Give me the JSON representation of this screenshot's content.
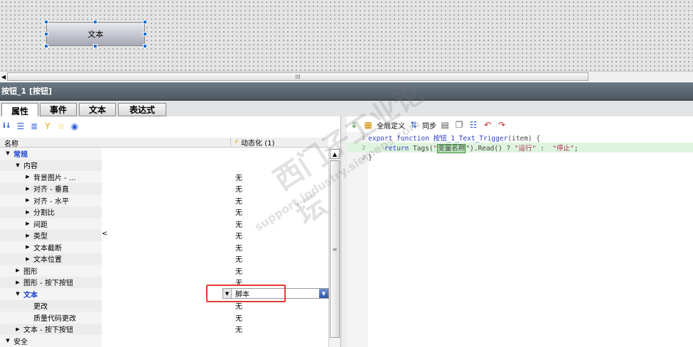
{
  "canvas": {
    "widget_label": "文本",
    "scroll_thumb_glyph": "III"
  },
  "window": {
    "title": "按钮_1 [按钮]"
  },
  "tabs": [
    {
      "label": "属性"
    },
    {
      "label": "事件"
    },
    {
      "label": "文本"
    },
    {
      "label": "表达式"
    }
  ],
  "properties": {
    "toolbar_icons": [
      "sort-alpha-icon",
      "list-view-icon",
      "tree-view-icon",
      "filter-icon",
      "favorite-star-icon",
      "visibility-eye-icon"
    ],
    "header_name": "名称",
    "header_dyn": "动态化 (1)",
    "rows": [
      {
        "expander": "▼",
        "name": "常规",
        "value": ""
      },
      {
        "expander": "▼",
        "name": "内容",
        "value": ""
      },
      {
        "expander": "▶",
        "name": "背景图片 - ...",
        "value": "无"
      },
      {
        "expander": "▶",
        "name": "对齐 - 垂直",
        "value": "无"
      },
      {
        "expander": "▶",
        "name": "对齐 - 水平",
        "value": "无"
      },
      {
        "expander": "▶",
        "name": "分割比",
        "value": "无"
      },
      {
        "expander": "▶",
        "name": "间距",
        "value": "无"
      },
      {
        "expander": "▶",
        "name": "类型",
        "value": "无"
      },
      {
        "expander": "▶",
        "name": "文本截断",
        "value": "无"
      },
      {
        "expander": "▶",
        "name": "文本位置",
        "value": "无"
      },
      {
        "expander": "▶",
        "name": "图形",
        "value": "无"
      },
      {
        "expander": "▶",
        "name": "图形 - 按下按钮",
        "value": "无"
      },
      {
        "expander": "▼",
        "name": "文本",
        "value": ""
      },
      {
        "expander": "",
        "name": "更改",
        "value": "无"
      },
      {
        "expander": "",
        "name": "质量代码更改",
        "value": "无"
      },
      {
        "expander": "▶",
        "name": "文本 - 按下按钮",
        "value": "无"
      },
      {
        "expander": "▼",
        "name": "安全",
        "value": ""
      }
    ],
    "stray_char": "<",
    "dropdown_value": "脚本"
  },
  "script": {
    "global_def_label": "全局定义",
    "sync_label": "同步",
    "lines": [
      {
        "num": "1",
        "parts": [
          {
            "t": "export function ",
            "c": "kw"
          },
          {
            "t": "按钮_1_Text_Trigger",
            "c": "kw"
          },
          {
            "t": "(item) {",
            "c": ""
          }
        ]
      },
      {
        "num": "2",
        "parts": [
          {
            "t": "    return ",
            "c": "kw"
          },
          {
            "t": "Tags(",
            "c": ""
          },
          {
            "t": "\"",
            "c": "str"
          },
          {
            "t": "变量名称",
            "c": "hl"
          },
          {
            "t": "\").Read() ? ",
            "c": ""
          },
          {
            "t": "\"运行\"",
            "c": "str"
          },
          {
            "t": " : ",
            "c": ""
          },
          {
            "t": " \"停止\"",
            "c": "str"
          },
          {
            "t": ";",
            "c": ""
          }
        ]
      },
      {
        "num": "3",
        "parts": [
          {
            "t": "}",
            "c": ""
          }
        ]
      }
    ]
  },
  "watermark": {
    "line1": "西门子工业论坛",
    "line2": "support.industry.siemens.com"
  },
  "colors": {
    "accent": "#1a3fd1",
    "highlight": "#e53a30",
    "title_bar": "#5b6771"
  }
}
